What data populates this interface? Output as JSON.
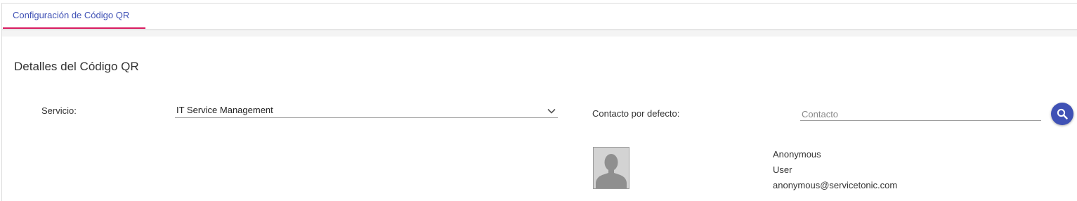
{
  "tabs": [
    {
      "label": "Configuración de Código QR",
      "active": true
    }
  ],
  "section": {
    "title": "Detalles del Código QR"
  },
  "form": {
    "servicio_label": "Servicio:",
    "servicio_value": "IT Service Management",
    "contacto_label": "Contacto por defecto:",
    "contacto_placeholder": "Contacto",
    "contacto_value": ""
  },
  "contact_card": {
    "first_name": "Anonymous",
    "last_name": "User",
    "email": "anonymous@servicetonic.com",
    "avatar_icon": "person-silhouette-icon"
  },
  "colors": {
    "accent": "#3f51b5",
    "tab_indicator": "#d81b60",
    "text": "#333333"
  },
  "icons": {
    "select": "chevron-down-icon",
    "search": "search-icon"
  }
}
